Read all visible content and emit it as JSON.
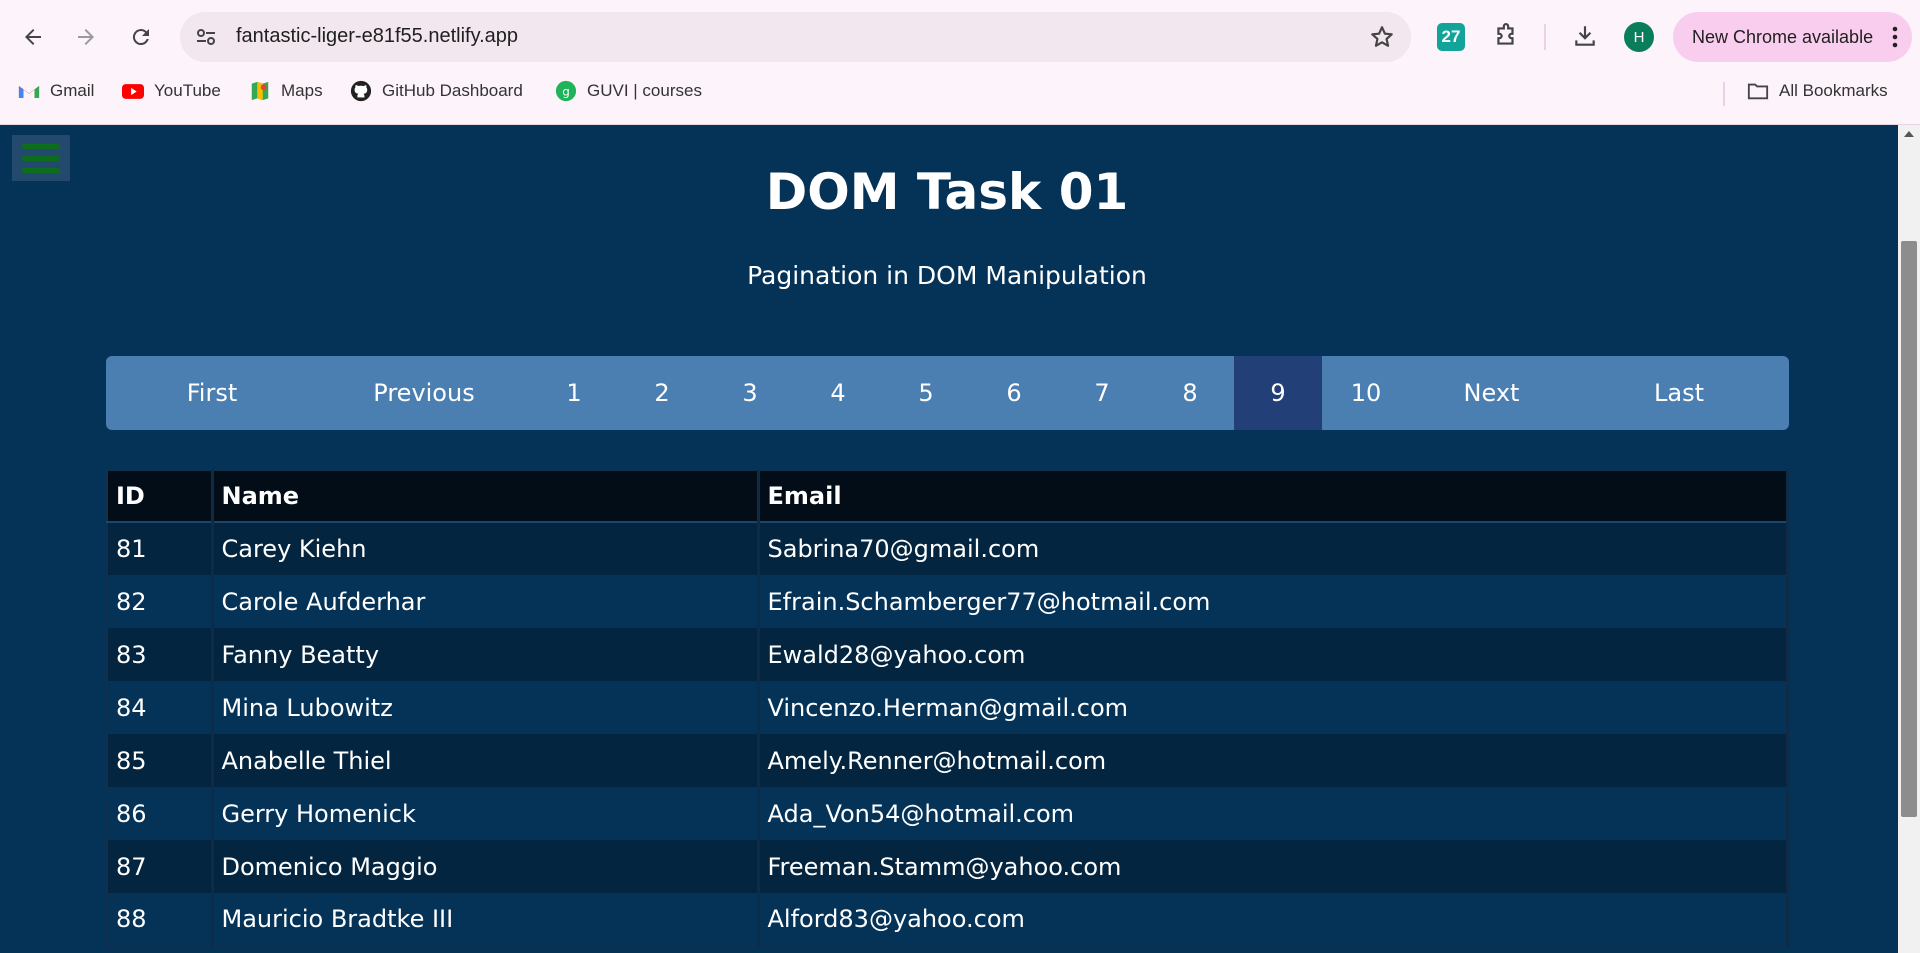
{
  "browser": {
    "url": "fantastic-liger-e81f55.netlify.app",
    "calendar_badge": "27",
    "avatar_initial": "H",
    "update_label": "New Chrome available",
    "bookmarks": [
      {
        "label": "Gmail",
        "icon": "gmail-icon"
      },
      {
        "label": "YouTube",
        "icon": "youtube-icon"
      },
      {
        "label": "Maps",
        "icon": "maps-icon"
      },
      {
        "label": "GitHub Dashboard",
        "icon": "github-icon"
      },
      {
        "label": "GUVI | courses",
        "icon": "guvi-icon"
      }
    ],
    "all_bookmarks": "All Bookmarks"
  },
  "page": {
    "title": "DOM Task 01",
    "subtitle": "Pagination in DOM Manipulation"
  },
  "pagination": {
    "first": "First",
    "previous": "Previous",
    "pages": [
      "1",
      "2",
      "3",
      "4",
      "5",
      "6",
      "7",
      "8",
      "9",
      "10"
    ],
    "active_page": "9",
    "next": "Next",
    "last": "Last"
  },
  "table": {
    "headers": [
      "ID",
      "Name",
      "Email"
    ],
    "rows": [
      [
        "81",
        "Carey Kiehn",
        "Sabrina70@gmail.com"
      ],
      [
        "82",
        "Carole Aufderhar",
        "Efrain.Schamberger77@hotmail.com"
      ],
      [
        "83",
        "Fanny Beatty",
        "Ewald28@yahoo.com"
      ],
      [
        "84",
        "Mina Lubowitz",
        "Vincenzo.Herman@gmail.com"
      ],
      [
        "85",
        "Anabelle Thiel",
        "Amely.Renner@hotmail.com"
      ],
      [
        "86",
        "Gerry Homenick",
        "Ada_Von54@hotmail.com"
      ],
      [
        "87",
        "Domenico Maggio",
        "Freeman.Stamm@yahoo.com"
      ],
      [
        "88",
        "Mauricio Bradtke III",
        "Alford83@yahoo.com"
      ]
    ]
  },
  "colors": {
    "page_bg": "#053358",
    "pager_bg": "#4b7fb2",
    "pager_active": "#233f78",
    "table_header_bg": "#030d18"
  }
}
